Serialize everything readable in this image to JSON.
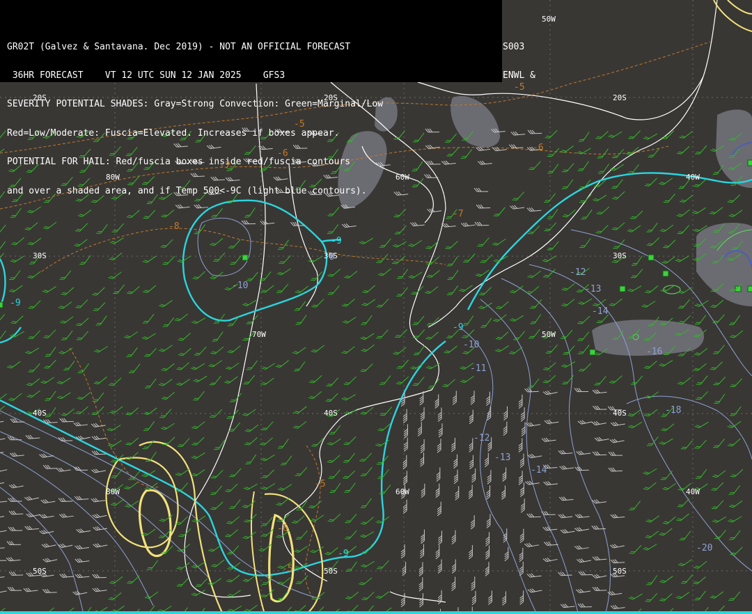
{
  "header": {
    "lines": [
      "GR02T (Galvez & Santavana. Dec 2019) - NOT AN OFFICIAL FORECAST",
      " 36HR FORECAST    VT 12 UTC SUN 12 JAN 2025    GFS3",
      "SEVERITY POTENTIAL SHADES: Gray=Strong Convection: Green=Marginal/Low",
      "Red=Low/Moderate: Fuscia=Elevated. Increases if boxes appear.",
      "POTENTIAL FOR HAIL: Red/fuscia boxes inside red/fuscia contours",
      "and over a shaded area, and if Temp 500<-9C (light blue contours)."
    ],
    "corner_lines": [
      "S003",
      "ENWL &"
    ]
  },
  "grid_labels": {
    "lat_20s_left": "20S",
    "lat_20s_mid": "20S",
    "lat_20s_right": "20S",
    "lat_30s_left": "30S",
    "lat_30s_mid": "30S",
    "lat_30s_right": "30S",
    "lat_40s_left": "40S",
    "lat_40s_mid": "40S",
    "lat_40s_right": "40S",
    "lat_50s_left": "50S",
    "lat_50s_mid": "50S",
    "lat_50s_right": "50S",
    "lon_80w_top": "80W",
    "lon_60w_top": "60W",
    "lon_40w_top": "40W",
    "lon_70w_mid": "70W",
    "lon_50w_mid": "50W",
    "lon_50w_top": "50W",
    "lon_80w_bot": "80W",
    "lon_60w_bot": "60W",
    "lon_40w_bot": "40W"
  },
  "contour_labels": {
    "temp500": [
      "-9",
      "-9",
      "-9",
      "-9",
      "-9",
      "-10",
      "-10",
      "-11",
      "-12",
      "-12",
      "-13",
      "-13",
      "-14",
      "-14",
      "-16",
      "-18",
      "-20"
    ],
    "orange": [
      "-5",
      "-5",
      "-6",
      "-6",
      "-7",
      "-7",
      "-8",
      "-6",
      "-5",
      "-5"
    ]
  },
  "colors": {
    "background": "#393734",
    "coastline": "#ffffff",
    "temp_cyan": "#2ad6df",
    "temp_contour": "#8da2d4",
    "orange_contour": "#c27a2a",
    "yellow_contour": "#f3e27a",
    "wind_barb": "#33b82a",
    "wind_barb_gray": "#c8c8c8",
    "gray_shade": "#6e6e76",
    "box_green": "#3cd23c"
  }
}
